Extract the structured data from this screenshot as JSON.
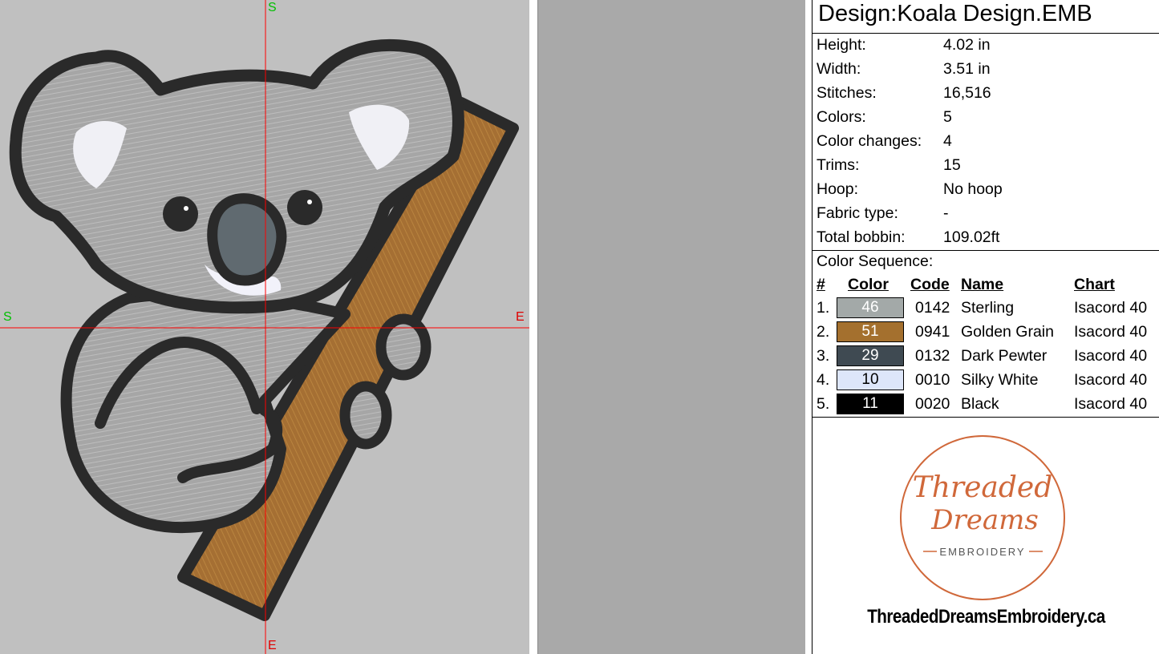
{
  "canvas": {
    "axis_top": "S",
    "axis_left": "S",
    "axis_right": "E",
    "axis_bottom": "E",
    "colors": {
      "background": "#c0c0c0",
      "crosshair": "#ff0000",
      "axis_start_label": "#00c000",
      "axis_end_label": "#e00000",
      "sterling": "#a8a8a8",
      "golden_grain": "#a57034",
      "dark_pewter": "#606a70",
      "silky_white": "#f2f2fa",
      "black": "#2a2a2a"
    },
    "artwork": "koala-embroidery"
  },
  "info": {
    "title": "Design:Koala Design.EMB",
    "properties": [
      {
        "label": "Height:",
        "value": "4.02 in"
      },
      {
        "label": "Width:",
        "value": "3.51 in"
      },
      {
        "label": "Stitches:",
        "value": "16,516"
      },
      {
        "label": "Colors:",
        "value": "5"
      },
      {
        "label": "Color changes:",
        "value": "4"
      },
      {
        "label": "Trims:",
        "value": "15"
      },
      {
        "label": "Hoop:",
        "value": "No hoop"
      },
      {
        "label": "Fabric type:",
        "value": "-"
      },
      {
        "label": "Total bobbin:",
        "value": "109.02ft"
      }
    ],
    "sequence_title": "Color Sequence:",
    "headers": {
      "num": "#",
      "color": "Color",
      "code": "Code",
      "name": "Name",
      "chart": "Chart"
    },
    "colors": [
      {
        "num": "1.",
        "swatch": "46",
        "hex": "#a3a9a8",
        "text_color": "#ffffff",
        "code": "0142",
        "name": "Sterling",
        "chart": "Isacord 40"
      },
      {
        "num": "2.",
        "swatch": "51",
        "hex": "#a4702e",
        "text_color": "#ffffff",
        "code": "0941",
        "name": "Golden Grain",
        "chart": "Isacord 40"
      },
      {
        "num": "3.",
        "swatch": "29",
        "hex": "#3f4a52",
        "text_color": "#ffffff",
        "code": "0132",
        "name": "Dark Pewter",
        "chart": "Isacord 40"
      },
      {
        "num": "4.",
        "swatch": "10",
        "hex": "#dde6fa",
        "text_color": "#000000",
        "code": "0010",
        "name": "Silky White",
        "chart": "Isacord 40"
      },
      {
        "num": "5.",
        "swatch": "11",
        "hex": "#000000",
        "text_color": "#ffffff",
        "code": "0020",
        "name": "Black",
        "chart": "Isacord 40"
      }
    ]
  },
  "logo": {
    "line1": "Threaded",
    "line2": "Dreams",
    "line3": "EMBROIDERY",
    "color": "#d0683a"
  },
  "website": "ThreadedDreamsEmbroidery.ca"
}
